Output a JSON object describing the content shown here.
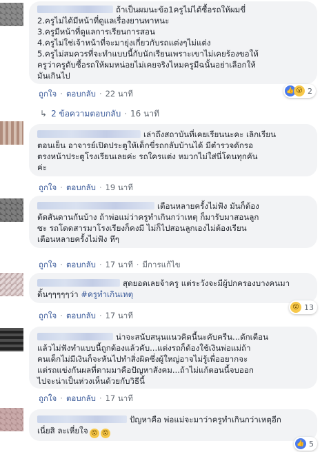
{
  "labels": {
    "like": "ถูกใจ",
    "reply": "ตอบกลับ",
    "edited": "มีการแก้ไข"
  },
  "colors": {
    "bubble": "#f2f3f5",
    "link": "#385898",
    "meta": "#606770"
  },
  "comments": [
    {
      "lines": [
        "ถ้าเป็นผมนะข้อ1ครูไม่ได้ซื้อรถให้ผมขี่",
        "2.ครูไม่ได้มีหน้าที่ดูแลเรื่องยานพาหนะ",
        "3.ครูมีหน้าที่ดูแลการเรียนการสอน",
        "4.ครูไม่ใช่เจ้าหน้าที่จะมายุ่งเกี่ยวกับรถแต่งๆไม่แต่ง",
        "5.ครูไม่สมควรที่จะทำแบบนี้กับนักเรียนเพราะเขาไม่เคยร้องขอให้",
        "ครูว่าครูดับซื้อรถให้ผมหน่อยไม่เคยจริงไหมครูมีฉนั้นอย่าเลือกให้",
        "มันเกินไป"
      ],
      "time": "22 นาที",
      "reactions": {
        "icons": [
          "like-icon",
          "wow-icon"
        ],
        "count": "2"
      }
    },
    {
      "lines": [
        "เล่าถึงสถาบันที่เคยเรียนนะคะ เลิกเรียน",
        "ตอนเย็น อาจารย์เปิดประตูให้เด็กขี่รถกลับบ้านได้ มีตำรวจดักรอ",
        "ตรงหน้าประตูโรงเรียนเลยค่ะ รถใครแต่ง หมวกไม่ใส่นี่โดนทุกคัน",
        "ค่ะ"
      ],
      "time": "19 นาที"
    },
    {
      "lines": [
        "เตือนหลายครั้งไม่ฟัง มันก็ต้อง",
        "ตัดสันดานกันบ้าง ถ้าพ่อแม่ว่าครูทำเกินกว่าเหตุ ก็มารับมาสอนลูก",
        "ซะ รถโดดสารมาโรงเรียงก็คงมี ไม่ก็ไปสอนลูกเองไม่ต้องเรียน",
        "เตือนหลายครั้งไม่ฟัง หึๆ"
      ],
      "time": "17 นาที",
      "edited": true
    },
    {
      "lines": [
        "สุดยอดเลยจ้าครู แต่ระวังจะมีผู้ปกครองบางคนมา",
        "ดิ้นๆๆๆๆๆว่า"
      ],
      "hashtag": "#ครูทำเกินเหตุ",
      "time": "17 นาที",
      "reactions": {
        "icons": [
          "wow-icon"
        ],
        "count": "13"
      }
    },
    {
      "lines": [
        "น่าจะสนับสนุนแนวคิดนี้นะคับครืน...ดักเตือน",
        "แล้วไม่ฟังทำแบบนี้ถูกต้องแล้วคับ...แต่งรถก็ต้องใช้เงินพ่อแม่ถ้า",
        "คนเด็กไม่มีเงินก็จะหันไปทำสิ่งผิดซึ่งผู้ใหญ่อาจไม่รู้เพื่ออยากจะ",
        "แต่รถแข่งกันผลที่ตามมาคือปัญหาสังคม...ถ้าไม่แก้ตอนนี้จบออก",
        "ไปจะน่าเป็นห่วงเห็นด้วยกับวิธีนี้"
      ],
      "time": "17 นาที"
    },
    {
      "lines": [
        "ปัญหาคือ พ่อแม่จะมาว่าครูทำเกินกว่าเหตุอีก",
        "เนี่ยสิ ละเหี่ยใจ"
      ],
      "time": "17 นาที",
      "reactions": {
        "icons": [
          "like-icon"
        ],
        "count": "5"
      }
    }
  ],
  "replies": {
    "label": "2 ข้อความตอบกลับ",
    "time": "16 นาที"
  }
}
